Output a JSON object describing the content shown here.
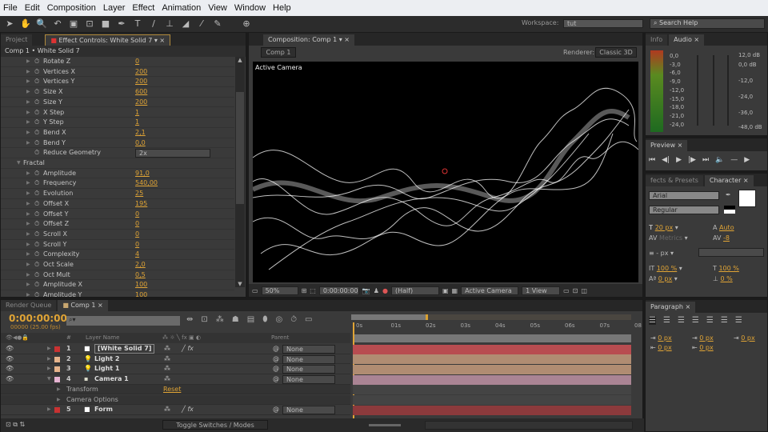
{
  "menu": [
    "File",
    "Edit",
    "Composition",
    "Layer",
    "Effect",
    "Animation",
    "View",
    "Window",
    "Help"
  ],
  "workspace": {
    "label": "Workspace:",
    "value": "tut"
  },
  "search": {
    "placeholder": "Search Help"
  },
  "left_panel": {
    "tabs": [
      "Project",
      "Effect Controls: White Solid 7"
    ],
    "header": "Comp 1 • White Solid 7",
    "rows": [
      {
        "label": "Rotate Z",
        "value": "0"
      },
      {
        "label": "Vertices X",
        "value": "200"
      },
      {
        "label": "Vertices Y",
        "value": "200"
      },
      {
        "label": "Size X",
        "value": "600"
      },
      {
        "label": "Size Y",
        "value": "200"
      },
      {
        "label": "X Step",
        "value": "1"
      },
      {
        "label": "Y Step",
        "value": "1"
      },
      {
        "label": "Bend X",
        "value": "2,1"
      },
      {
        "label": "Bend Y",
        "value": "0,0"
      },
      {
        "label": "Reduce Geometry",
        "value": "2x",
        "type": "dropdown"
      },
      {
        "label": "Fractal",
        "type": "group"
      },
      {
        "label": "Amplitude",
        "value": "91,0"
      },
      {
        "label": "Frequency",
        "value": "540,00"
      },
      {
        "label": "Evolution",
        "value": "25"
      },
      {
        "label": "Offset X",
        "value": "195"
      },
      {
        "label": "Offset Y",
        "value": "0"
      },
      {
        "label": "Offset Z",
        "value": "0"
      },
      {
        "label": "Scroll X",
        "value": "0"
      },
      {
        "label": "Scroll Y",
        "value": "0"
      },
      {
        "label": "Complexity",
        "value": "4"
      },
      {
        "label": "Oct Scale",
        "value": "2,0"
      },
      {
        "label": "Oct Mult",
        "value": "0,5"
      },
      {
        "label": "Amplitude X",
        "value": "100"
      },
      {
        "label": "Amplitude Y",
        "value": "100"
      }
    ]
  },
  "comp_panel": {
    "tab": "Composition: Comp 1",
    "breadcrumb": "Comp 1",
    "renderer_label": "Renderer:",
    "renderer": "Classic 3D",
    "view_label": "Active Camera",
    "footer": {
      "zoom": "50%",
      "timecode": "0:00:00:00",
      "resolution": "(Half)",
      "camera": "Active Camera",
      "views": "1 View"
    }
  },
  "audio": {
    "tabs": [
      "Info",
      "Audio"
    ],
    "levels": [
      "0,0",
      "-3,0",
      "-6,0",
      "-9,0",
      "-12,0",
      "-15,0",
      "-18,0",
      "-21,0",
      "-24,0"
    ],
    "db": [
      "12,0 dB",
      "0,0 dB",
      "-12,0",
      "-24,0",
      "-36,0",
      "-48,0 dB"
    ]
  },
  "preview": {
    "tab": "Preview"
  },
  "character": {
    "tabs": [
      "fects & Presets",
      "Character"
    ],
    "font": "Arial",
    "style": "Regular",
    "size": "20 px",
    "leading": "Auto",
    "kerning": "Metrics",
    "tracking": "-8",
    "stroke": "- px",
    "vscale": "100 %",
    "hscale": "100 %",
    "baseline": "0 px",
    "tsume": "0 %",
    "fill_color": "#ffffff"
  },
  "paragraph": {
    "tab": "Paragraph",
    "indents": [
      "0 px",
      "0 px",
      "0 px",
      "0 px",
      "0 px"
    ]
  },
  "timeline": {
    "tabs": [
      "Render Queue",
      "Comp 1"
    ],
    "timecode": "0:00:00:00",
    "fps": "00000 (25.00 fps)",
    "headers": {
      "name": "Layer Name",
      "parent": "Parent",
      "switches": "fx"
    },
    "ticks": [
      "0s",
      "01s",
      "02s",
      "03s",
      "04s",
      "05s",
      "06s",
      "07s",
      "08"
    ],
    "layers": [
      {
        "num": "1",
        "name": "[White Solid 7]",
        "color": "#c83232",
        "parent": "None",
        "track": "#b84c50",
        "fx": true,
        "selected": true
      },
      {
        "num": "2",
        "name": "Light 2",
        "color": "#e6b48c",
        "parent": "None",
        "track": "#b08c72"
      },
      {
        "num": "3",
        "name": "Light 1",
        "color": "#e6b48c",
        "parent": "None",
        "track": "#b08c72"
      },
      {
        "num": "4",
        "name": "Camera 1",
        "color": "#e6b4d2",
        "parent": "None",
        "track": "#aa8494",
        "expanded": true
      },
      {
        "sub": "Transform",
        "value": "Reset"
      },
      {
        "sub": "Camera Options"
      },
      {
        "num": "5",
        "name": "Form",
        "color": "#c83232",
        "parent": "None",
        "track": "#8c3a3c",
        "fx": true
      }
    ],
    "toggle_label": "Toggle Switches / Modes"
  }
}
